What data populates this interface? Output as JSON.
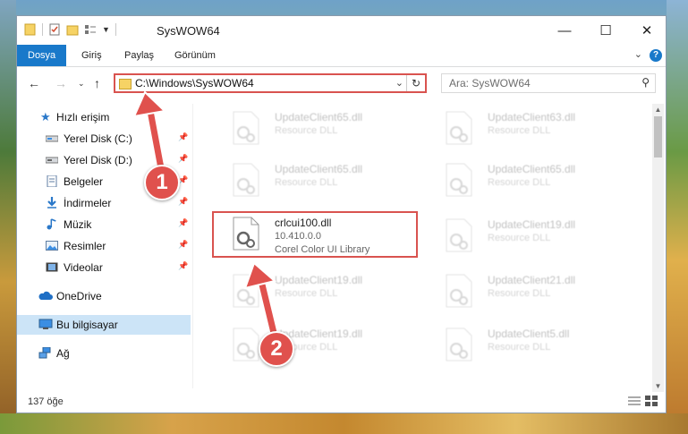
{
  "window": {
    "title": "SysWOW64",
    "controls": {
      "minimize": "—",
      "maximize": "☐",
      "close": "✕"
    }
  },
  "ribbon": {
    "tabs": [
      "Dosya",
      "Giriş",
      "Paylaş",
      "Görünüm"
    ],
    "help": "?"
  },
  "address": {
    "path": "C:\\Windows\\SysWOW64",
    "search_placeholder": "Ara: SysWOW64"
  },
  "sidebar": {
    "items": [
      {
        "label": "Hızlı erişim",
        "icon": "star-icon"
      },
      {
        "label": "Yerel Disk (C:)",
        "icon": "drive-icon",
        "pinned": true
      },
      {
        "label": "Yerel Disk (D:)",
        "icon": "drive-icon",
        "pinned": true
      },
      {
        "label": "Belgeler",
        "icon": "documents-icon",
        "pinned": true
      },
      {
        "label": "İndirmeler",
        "icon": "download-icon",
        "pinned": true
      },
      {
        "label": "Müzik",
        "icon": "music-icon",
        "pinned": true
      },
      {
        "label": "Resimler",
        "icon": "pictures-icon",
        "pinned": true
      },
      {
        "label": "Videolar",
        "icon": "videos-icon",
        "pinned": true
      },
      {
        "label": "OneDrive",
        "icon": "cloud-icon"
      },
      {
        "label": "Bu bilgisayar",
        "icon": "computer-icon",
        "selected": true
      },
      {
        "label": "Ağ",
        "icon": "network-icon"
      }
    ]
  },
  "files": [
    {
      "name": "UpdateClient65.dll",
      "type": "Resource DLL"
    },
    {
      "name": "UpdateClient63.dll",
      "type": "Resource DLL"
    },
    {
      "name": "UpdateClient65.dll",
      "type": "Resource DLL"
    },
    {
      "name": "UpdateClient65.dll",
      "type": "Resource DLL"
    },
    {
      "name": "crlcui100.dll",
      "version": "10.410.0.0",
      "type": "Corel Color UI Library",
      "highlighted": true
    },
    {
      "name": "UpdateClient19.dll",
      "type": "Resource DLL"
    },
    {
      "name": "UpdateClient19.dll",
      "type": "Resource DLL"
    },
    {
      "name": "UpdateClient21.dll",
      "type": "Resource DLL"
    },
    {
      "name": "UpdateClient19.dll",
      "type": "Resource DLL"
    },
    {
      "name": "UpdateClient5.dll",
      "type": "Resource DLL"
    }
  ],
  "status": {
    "item_count": "137 öğe"
  },
  "annotations": {
    "step1": "1",
    "step2": "2"
  },
  "colors": {
    "accent": "#1979ca",
    "highlight": "#d9534f",
    "selection": "#cce4f7"
  }
}
